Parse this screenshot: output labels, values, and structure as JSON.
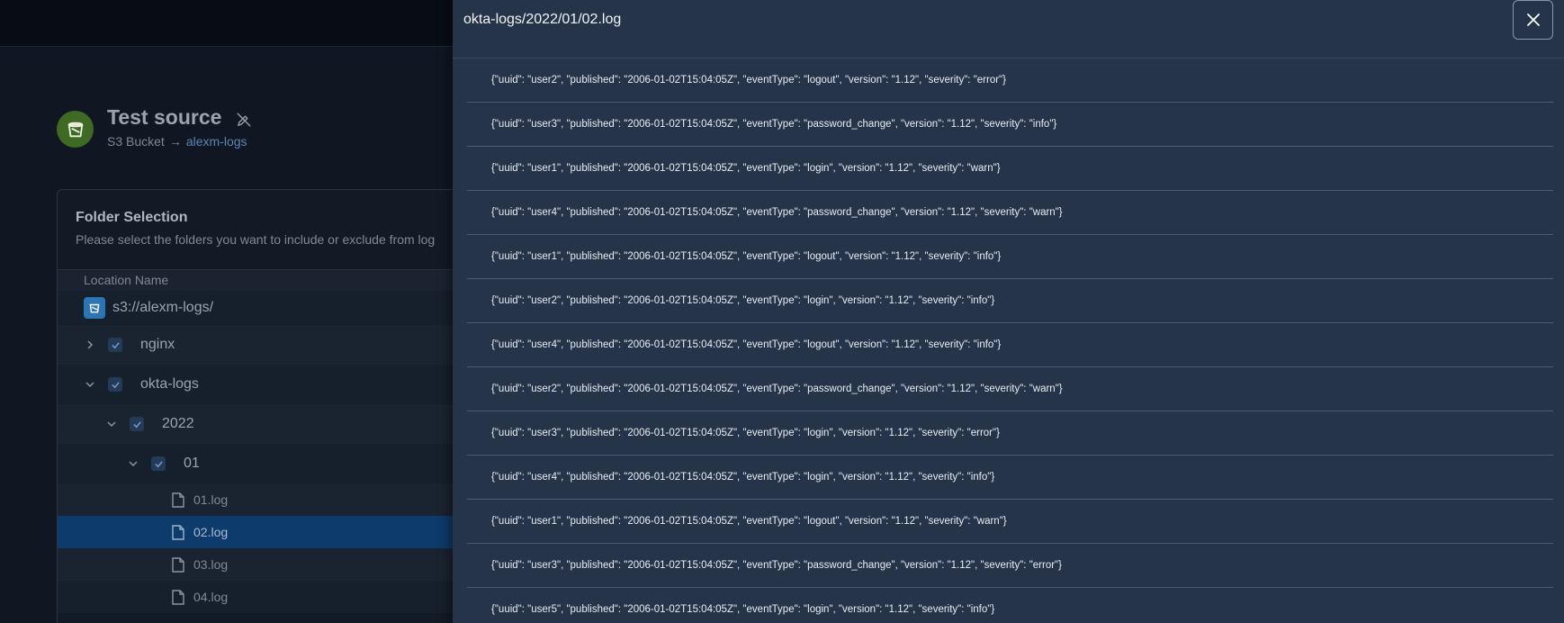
{
  "source": {
    "title": "Test source",
    "type": "S3 Bucket",
    "arrow": "→",
    "bucket": "alexm-logs"
  },
  "folder_selection": {
    "title": "Folder Selection",
    "description": "Please select the folders you want to include or exclude from log",
    "column_header": "Location Name",
    "root": "s3://alexm-logs/",
    "folders": [
      "nginx",
      "okta-logs",
      "2022",
      "01"
    ],
    "files": [
      "01.log",
      "02.log",
      "03.log",
      "04.log"
    ],
    "selected_file": "02.log"
  },
  "drawer": {
    "title": "okta-logs/2022/01/02.log",
    "lines": [
      "{\"uuid\": \"user2\", \"published\": \"2006-01-02T15:04:05Z\", \"eventType\": \"logout\", \"version\": \"1.12\", \"severity\": \"error\"}",
      "{\"uuid\": \"user3\", \"published\": \"2006-01-02T15:04:05Z\", \"eventType\": \"password_change\", \"version\": \"1.12\", \"severity\": \"info\"}",
      "{\"uuid\": \"user1\", \"published\": \"2006-01-02T15:04:05Z\", \"eventType\": \"login\", \"version\": \"1.12\", \"severity\": \"warn\"}",
      "{\"uuid\": \"user4\", \"published\": \"2006-01-02T15:04:05Z\", \"eventType\": \"password_change\", \"version\": \"1.12\", \"severity\": \"warn\"}",
      "{\"uuid\": \"user1\", \"published\": \"2006-01-02T15:04:05Z\", \"eventType\": \"logout\", \"version\": \"1.12\", \"severity\": \"info\"}",
      "{\"uuid\": \"user2\", \"published\": \"2006-01-02T15:04:05Z\", \"eventType\": \"login\", \"version\": \"1.12\", \"severity\": \"info\"}",
      "{\"uuid\": \"user4\", \"published\": \"2006-01-02T15:04:05Z\", \"eventType\": \"logout\", \"version\": \"1.12\", \"severity\": \"info\"}",
      "{\"uuid\": \"user2\", \"published\": \"2006-01-02T15:04:05Z\", \"eventType\": \"password_change\", \"version\": \"1.12\", \"severity\": \"warn\"}",
      "{\"uuid\": \"user3\", \"published\": \"2006-01-02T15:04:05Z\", \"eventType\": \"login\", \"version\": \"1.12\", \"severity\": \"error\"}",
      "{\"uuid\": \"user4\", \"published\": \"2006-01-02T15:04:05Z\", \"eventType\": \"login\", \"version\": \"1.12\", \"severity\": \"info\"}",
      "{\"uuid\": \"user1\", \"published\": \"2006-01-02T15:04:05Z\", \"eventType\": \"logout\", \"version\": \"1.12\", \"severity\": \"warn\"}",
      "{\"uuid\": \"user3\", \"published\": \"2006-01-02T15:04:05Z\", \"eventType\": \"password_change\", \"version\": \"1.12\", \"severity\": \"error\"}",
      "{\"uuid\": \"user5\", \"published\": \"2006-01-02T15:04:05Z\", \"eventType\": \"login\", \"version\": \"1.12\", \"severity\": \"info\"}"
    ]
  },
  "colors": {
    "drawer_bg": "#263449",
    "selected_row": "#0d3b6b",
    "source_avatar": "#3f6a24",
    "bucket_link": "#5a86b6"
  }
}
